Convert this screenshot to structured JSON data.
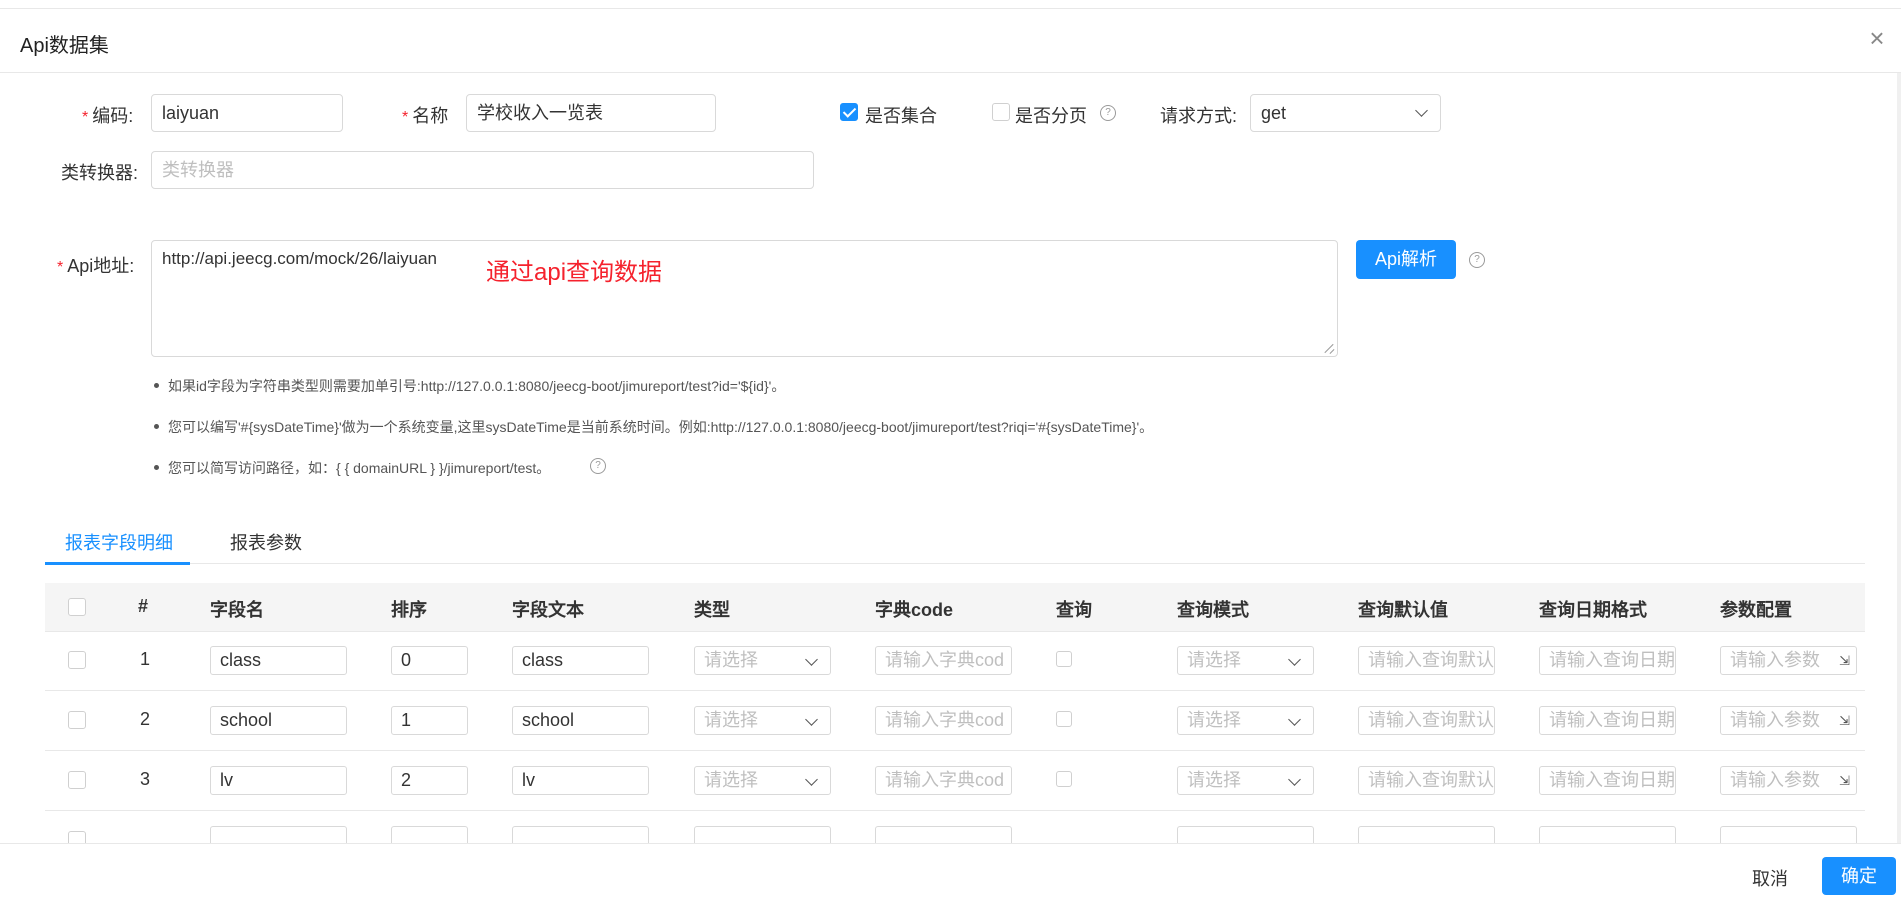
{
  "dialog": {
    "title": "Api数据集"
  },
  "form": {
    "code_label": "编码:",
    "code_value": "laiyuan",
    "name_label": "名称",
    "name_value": "学校收入一览表",
    "is_collection_label": "是否集合",
    "is_paging_label": "是否分页",
    "method_label": "请求方式:",
    "method_value": "get",
    "converter_label": "类转换器:",
    "converter_placeholder": "类转换器",
    "api_label": "Api地址:",
    "api_value": "http://api.jeecg.com/mock/26/laiyuan",
    "api_annotation": "通过api查询数据",
    "api_parse_button": "Api解析"
  },
  "hints": [
    "如果id字段为字符串类型则需要加单引号:http://127.0.0.1:8080/jeecg-boot/jimureport/test?id='${id}'。",
    "您可以编写'#{sysDateTime}'做为一个系统变量,这里sysDateTime是当前系统时间。例如:http://127.0.0.1:8080/jeecg-boot/jimureport/test?riqi='#{sysDateTime}'。",
    "您可以简写访问路径，如：{ { domainURL } }/jimureport/test。"
  ],
  "tabs": [
    "报表字段明细",
    "报表参数"
  ],
  "table": {
    "headers": [
      "#",
      "字段名",
      "排序",
      "字段文本",
      "类型",
      "字典code",
      "查询",
      "查询模式",
      "查询默认值",
      "查询日期格式",
      "参数配置"
    ],
    "placeholders": {
      "type": "请选择",
      "dict": "请输入字典cod",
      "query_mode": "请选择",
      "default": "请输入查询默认",
      "date_format": "请输入查询日期",
      "param": "请输入参数"
    },
    "rows": [
      {
        "num": "1",
        "field": "class",
        "order": "0",
        "text": "class"
      },
      {
        "num": "2",
        "field": "school",
        "order": "1",
        "text": "school"
      },
      {
        "num": "3",
        "field": "lv",
        "order": "2",
        "text": "lv"
      }
    ]
  },
  "footer": {
    "cancel": "取消",
    "ok": "确定"
  }
}
